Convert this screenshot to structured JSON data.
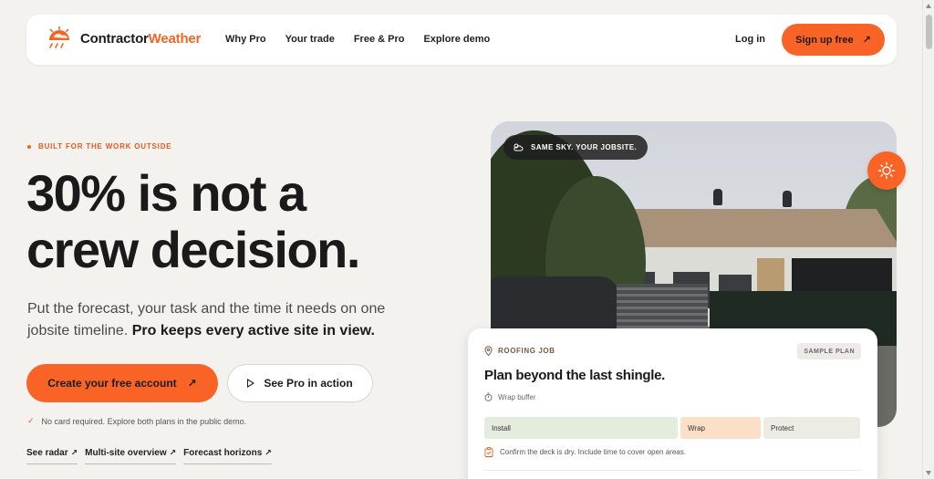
{
  "nav": {
    "logo_part1": "Contractor",
    "logo_part2": "Weather",
    "links": [
      "Why Pro",
      "Your trade",
      "Free & Pro",
      "Explore demo"
    ],
    "login": "Log in",
    "signup": "Sign up free",
    "signup_icon": "arrow-up-right-icon"
  },
  "hero": {
    "eyebrow": "BUILT FOR THE WORK OUTSIDE",
    "headline_line1": "30% is not a",
    "headline_line2": "crew decision.",
    "sub_plain": "Put the forecast, your task and the time it needs on one jobsite timeline.",
    "sub_bold": "Pro keeps every active site in view.",
    "cta_primary": "Create your free account",
    "cta_secondary": "See Pro in action",
    "note": "No card required. Explore both plans in the public demo.",
    "links": [
      "See radar",
      "Multi-site overview",
      "Forecast horizons"
    ]
  },
  "photo": {
    "badge": "SAME SKY. YOUR JOBSITE.",
    "badge_icon": "cloud-sun-icon",
    "sun_button_icon": "sun-icon"
  },
  "card": {
    "tag": "ROOFING JOB",
    "sample_badge": "SAMPLE PLAN",
    "title": "Plan beyond the last shingle.",
    "buffer": "Wrap buffer",
    "segments": [
      "Install",
      "Wrap",
      "Protect"
    ],
    "note": "Confirm the deck is dry. Include time to cover open areas."
  },
  "colors": {
    "accent": "#fa6326",
    "background": "#f4f2ef"
  }
}
